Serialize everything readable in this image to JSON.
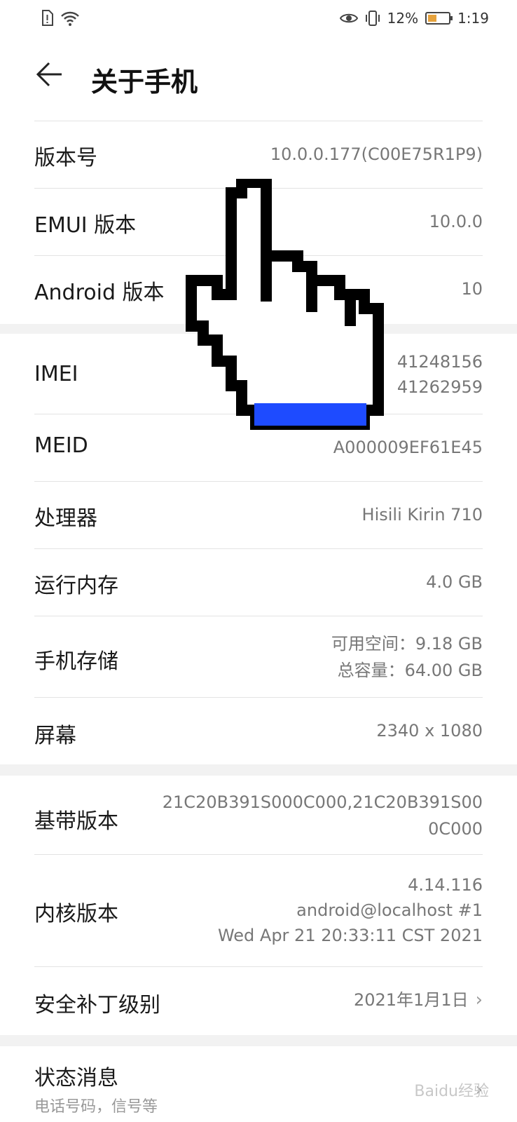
{
  "status_bar": {
    "battery": "12%",
    "time": "1:19",
    "battery_color": "#e6a23c"
  },
  "header": {
    "title": "关于手机"
  },
  "rows": {
    "build": {
      "label": "版本号",
      "value": "10.0.0.177(C00E75R1P9)"
    },
    "emui": {
      "label": "EMUI 版本",
      "value": "10.0.0"
    },
    "android": {
      "label": "Android 版本",
      "value": "10"
    },
    "imei": {
      "label": "IMEI",
      "value1": "41248156",
      "value2": "41262959"
    },
    "meid": {
      "label": "MEID",
      "value": "A000009EF61E45"
    },
    "cpu": {
      "label": "处理器",
      "value": "Hisili  Kirin 710"
    },
    "ram": {
      "label": "运行内存",
      "value": "4.0 GB"
    },
    "storage": {
      "label": "手机存储",
      "value1": "可用空间：9.18 GB",
      "value2": "总容量：64.00 GB"
    },
    "screen": {
      "label": "屏幕",
      "value": "2340 x 1080"
    },
    "baseband": {
      "label": "基带版本",
      "value1": "21C20B391S000C000,21C20B391S00",
      "value2": "0C000"
    },
    "kernel": {
      "label": "内核版本",
      "value1": "4.14.116",
      "value2": "android@localhost #1",
      "value3": "Wed Apr 21 20:33:11 CST 2021"
    },
    "patch": {
      "label": "安全补丁级别",
      "value": "2021年1月1日"
    },
    "status": {
      "label": "状态消息",
      "sub": "电话号码，信号等"
    }
  },
  "watermark": "Baidu经验",
  "colors": {
    "cursor_accent": "#1e4bff"
  }
}
